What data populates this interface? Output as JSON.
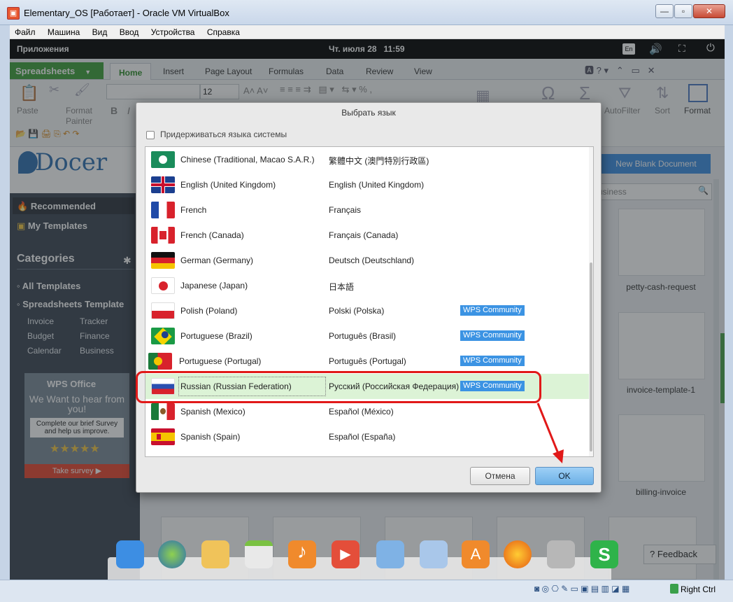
{
  "window": {
    "title": "Elementary_OS [Работает] - Oracle VM VirtualBox",
    "menu": [
      "Файл",
      "Машина",
      "Вид",
      "Ввод",
      "Устройства",
      "Справка"
    ],
    "host_key": "Right Ctrl"
  },
  "os_bar": {
    "apps": "Приложения",
    "datetime": "Чт. июля 28   11:59",
    "lang": "En"
  },
  "ribbon": {
    "app_button": "Spreadsheets",
    "tabs": [
      "Home",
      "Insert",
      "Page Layout",
      "Formulas",
      "Data",
      "Review",
      "View"
    ],
    "active_tab": "Home",
    "font_size": "12",
    "paste": "Paste",
    "format_painter": "Format Painter",
    "autofilter": "AutoFilter",
    "sort": "Sort",
    "format": "Format"
  },
  "docer": {
    "logo": "Docer",
    "recommended": "Recommended",
    "my_templates": "My Templates",
    "categories": "Categories",
    "all_templates": "All Templates",
    "spreadsheets_template": "Spreadsheets Template",
    "subcategories": [
      "Invoice",
      "Tracker",
      "Budget",
      "Finance",
      "Calendar",
      "Business"
    ],
    "ad": {
      "brand": "WPS Office",
      "headline": "We Want to hear from you!",
      "body": "Complete our brief Survey and help us improve.",
      "cta": "Take survey ▶"
    },
    "new_blank": "New Blank Document",
    "search_value": "usiness",
    "thumbnails": [
      "petty-cash-request",
      "invoice-template-1",
      "billing-invoice"
    ],
    "feedback": "Feedback"
  },
  "dialog": {
    "title": "Выбрать язык",
    "checkbox_label": "Придерживаться языка системы",
    "languages": [
      {
        "name": "Chinese (Traditional, Macao S.A.R.)",
        "native": "繁體中文 (澳門特別行政區)",
        "badge": ""
      },
      {
        "name": "English (United Kingdom)",
        "native": "English (United Kingdom)",
        "badge": ""
      },
      {
        "name": "French",
        "native": "Français",
        "badge": ""
      },
      {
        "name": "French (Canada)",
        "native": "Français (Canada)",
        "badge": ""
      },
      {
        "name": "German (Germany)",
        "native": "Deutsch (Deutschland)",
        "badge": ""
      },
      {
        "name": "Japanese (Japan)",
        "native": "日本語",
        "badge": ""
      },
      {
        "name": "Polish (Poland)",
        "native": "Polski (Polska)",
        "badge": "WPS Community"
      },
      {
        "name": "Portuguese (Brazil)",
        "native": "Português (Brasil)",
        "badge": "WPS Community"
      },
      {
        "name": "Portuguese (Portugal)",
        "native": "Português (Portugal)",
        "badge": "WPS Community"
      },
      {
        "name": "Russian (Russian Federation)",
        "native": "Русский (Российская Федерация)",
        "badge": "WPS Community"
      },
      {
        "name": "Spanish (Mexico)",
        "native": "Español (México)",
        "badge": ""
      },
      {
        "name": "Spanish (Spain)",
        "native": "Español (España)",
        "badge": ""
      }
    ],
    "selected": "Russian (Russian Federation)",
    "cancel": "Отмена",
    "ok": "OK"
  }
}
